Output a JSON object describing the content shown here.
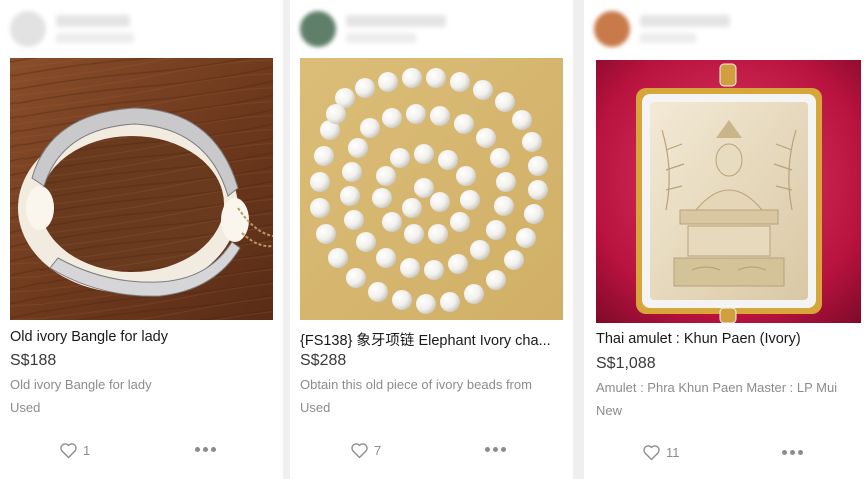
{
  "listings": [
    {
      "title": "Old ivory Bangle for lady",
      "price": "S$188",
      "description": "Old ivory Bangle for lady",
      "condition": "Used",
      "likes": "1"
    },
    {
      "title": "{FS138} 象牙项链 Elephant Ivory cha...",
      "price": "S$288",
      "description": "Obtain this old piece of ivory beads from",
      "condition": "Used",
      "likes": "7"
    },
    {
      "title": "Thai amulet : Khun Paen (Ivory)",
      "price": "S$1,088",
      "description": "Amulet : Phra Khun Paen Master : LP Mui",
      "condition": "New",
      "likes": "11"
    }
  ],
  "icons": {
    "like": "heart-outline-icon",
    "more": "more-horizontal-icon"
  },
  "colors": {
    "page_background": "#efefef",
    "card_background": "#ffffff",
    "title_text": "#1a1a1a",
    "muted_text": "#8c8c8c"
  }
}
